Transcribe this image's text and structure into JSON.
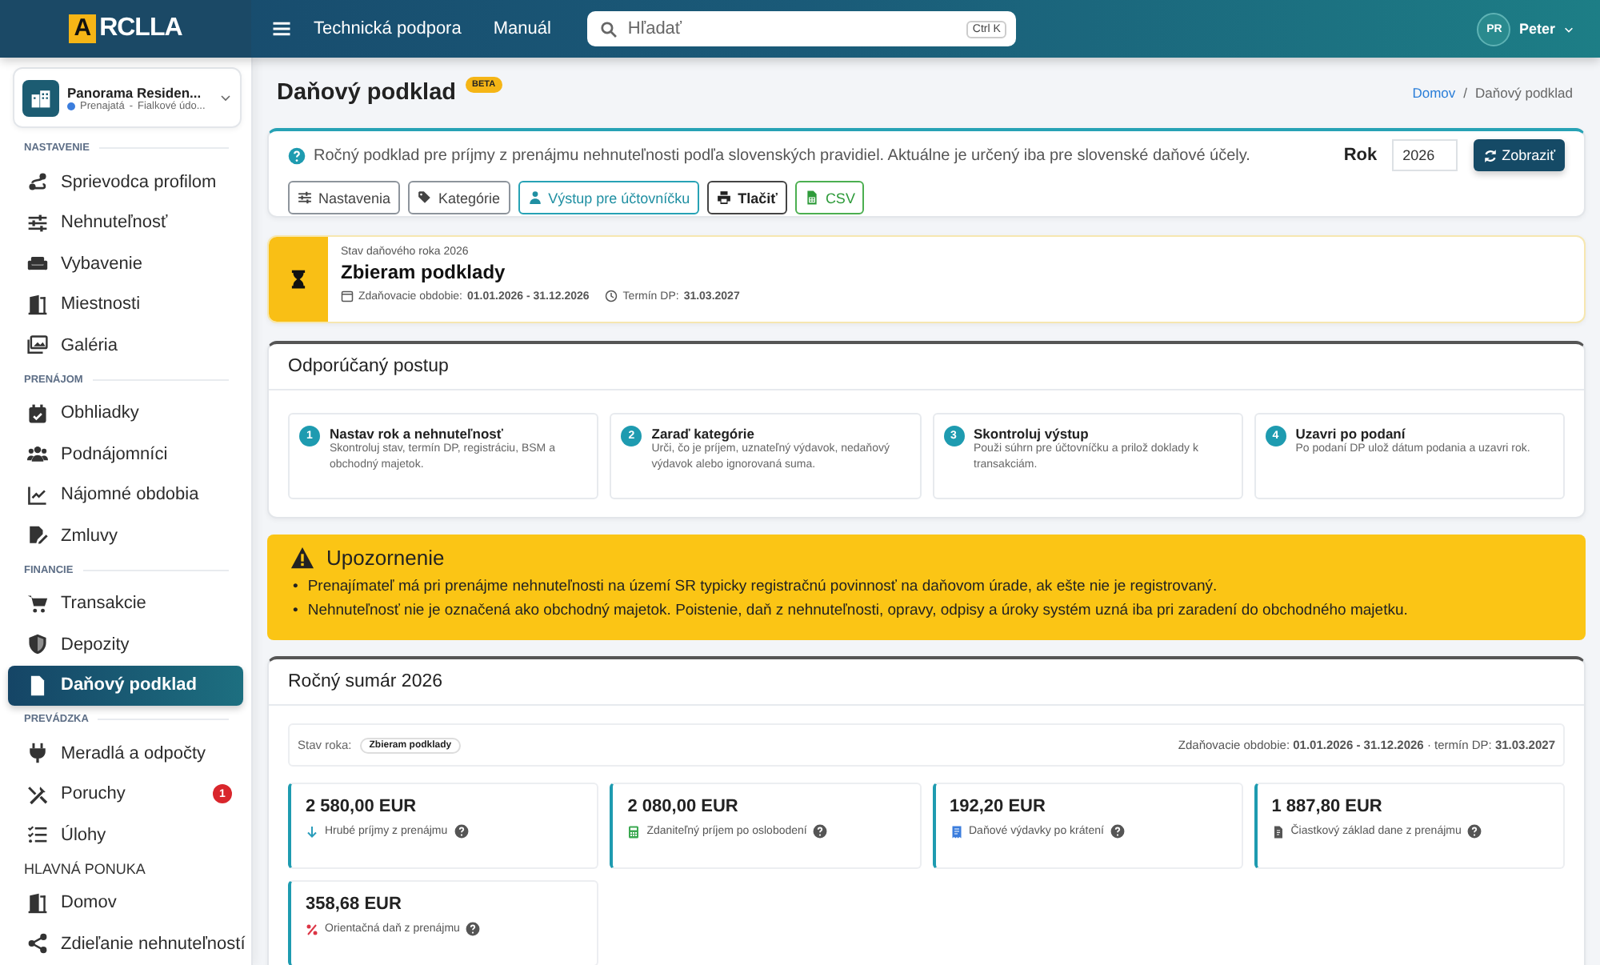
{
  "topbar": {
    "logo_mark": "A",
    "logo_text": "RCLLA",
    "nav_links": [
      "Technická podpora",
      "Manuál"
    ],
    "search": {
      "placeholder": "Hľadať",
      "shortcut": "Ctrl K"
    },
    "user": {
      "initials": "PR",
      "name": "Peter"
    }
  },
  "property": {
    "name": "Panorama Residen...",
    "status": "Prenajatá",
    "separator": "-",
    "location": "Fialkové údo..."
  },
  "sidebar": {
    "items": [
      {
        "kind": "section",
        "label": "NASTAVENIE"
      },
      {
        "kind": "item",
        "label": "Sprievodca profilom",
        "selected": false
      },
      {
        "kind": "item",
        "label": "Nehnuteľnosť",
        "selected": false
      },
      {
        "kind": "item",
        "label": "Vybavenie",
        "selected": false
      },
      {
        "kind": "item",
        "label": "Miestnosti",
        "selected": false
      },
      {
        "kind": "item",
        "label": "Galéria",
        "selected": false
      },
      {
        "kind": "section",
        "label": "PRENÁJOM"
      },
      {
        "kind": "item",
        "label": "Obhliadky",
        "selected": false
      },
      {
        "kind": "item",
        "label": "Podnájomníci",
        "selected": false
      },
      {
        "kind": "item",
        "label": "Nájomné obdobia",
        "selected": false
      },
      {
        "kind": "item",
        "label": "Zmluvy",
        "selected": false
      },
      {
        "kind": "section",
        "label": "FINANCIE"
      },
      {
        "kind": "item",
        "label": "Transakcie",
        "selected": false
      },
      {
        "kind": "item",
        "label": "Depozity",
        "selected": false
      },
      {
        "kind": "item",
        "label": "Daňový podklad",
        "selected": true
      },
      {
        "kind": "section",
        "label": "PREVÁDZKA"
      },
      {
        "kind": "item",
        "label": "Meradlá a odpočty",
        "selected": false
      },
      {
        "kind": "item",
        "label": "Poruchy",
        "selected": false,
        "badge": "1"
      },
      {
        "kind": "item",
        "label": "Úlohy",
        "selected": false
      },
      {
        "kind": "heading",
        "label": "HLAVNÁ PONUKA"
      },
      {
        "kind": "item",
        "label": "Domov",
        "selected": false
      },
      {
        "kind": "item",
        "label": "Zdieľanie nehnuteľností",
        "selected": false
      }
    ]
  },
  "page": {
    "title": "Daňový podklad",
    "badge": "BETA",
    "breadcrumb": [
      "Domov",
      "Daňový podklad"
    ],
    "breadcrumb_separator": "/"
  },
  "info": {
    "text": "Ročný podklad pre príjmy z prenájmu nehnuteľnosti podľa slovenských pravidiel. Aktuálne je určený iba pre slovenské daňové účely.",
    "year_label": "Rok",
    "year_value": "2026",
    "show_button": "Zobraziť",
    "buttons": [
      {
        "kind": "default",
        "label": "Nastavenia"
      },
      {
        "kind": "default",
        "label": "Kategórie"
      },
      {
        "kind": "info",
        "label": "Výstup pre účtovníčku"
      },
      {
        "kind": "dark",
        "label": "Tlačiť"
      },
      {
        "kind": "success",
        "label": "CSV"
      }
    ]
  },
  "status": {
    "caption": "Stav daňového roka 2026",
    "title": "Zbieram podklady",
    "period": "Zdaňovacie obdobie: **01.01.2026 - 31.12.2026**",
    "deadline": "Termín DP: **31.03.2027**"
  },
  "steps": {
    "title": "Odporúčaný postup",
    "items": [
      {
        "number": "1",
        "title": "Nastav rok a nehnuteľnosť",
        "text": "Skontroluj stav, termín DP, registráciu, BSM a obchodný majetok."
      },
      {
        "number": "2",
        "title": "Zaraď kategórie",
        "text": "Urči, čo je príjem, uznateľný výdavok, nedaňový výdavok alebo ignorovaná suma."
      },
      {
        "number": "3",
        "title": "Skontroluj výstup",
        "text": "Použi súhrn pre účtovníčku a prilož doklady k transakciám."
      },
      {
        "number": "4",
        "title": "Uzavri po podaní",
        "text": "Po podaní DP ulož dátum podania a uzavri rok."
      }
    ]
  },
  "warning": {
    "title": "Upozornenie",
    "bullet": "•",
    "items": [
      "Prenajímateľ má pri prenájme nehnuteľnosti na území SR typicky registračnú povinnosť na daňovom úrade, ak ešte nie je registrovaný.",
      "Nehnuteľnosť nie je označená ako obchodný majetok. Poistenie, daň z nehnuteľnosti, opravy, odpisy a úroky systém uzná iba pri zaradení do obchodného majetku."
    ]
  },
  "summary": {
    "title": "Ročný sumár 2026",
    "state_label": "Stav roka:",
    "state_badge": "Zbieram podklady",
    "period": "Zdaňovacie obdobie: **01.01.2026 - 31.12.2026** · termín DP: **31.03.2027**",
    "metrics": [
      {
        "value": "2 580,00 EUR",
        "label": "Hrubé príjmy z prenájmu"
      },
      {
        "value": "2 080,00 EUR",
        "label": "Zdaniteľný príjem po oslobodení"
      },
      {
        "value": "192,20 EUR",
        "label": "Daňové výdavky po krátení"
      },
      {
        "value": "1 887,80 EUR",
        "label": "Čiastkový základ dane z prenájmu"
      },
      {
        "value": "358,68 EUR",
        "label": "Orientačná daň z prenájmu"
      }
    ]
  }
}
